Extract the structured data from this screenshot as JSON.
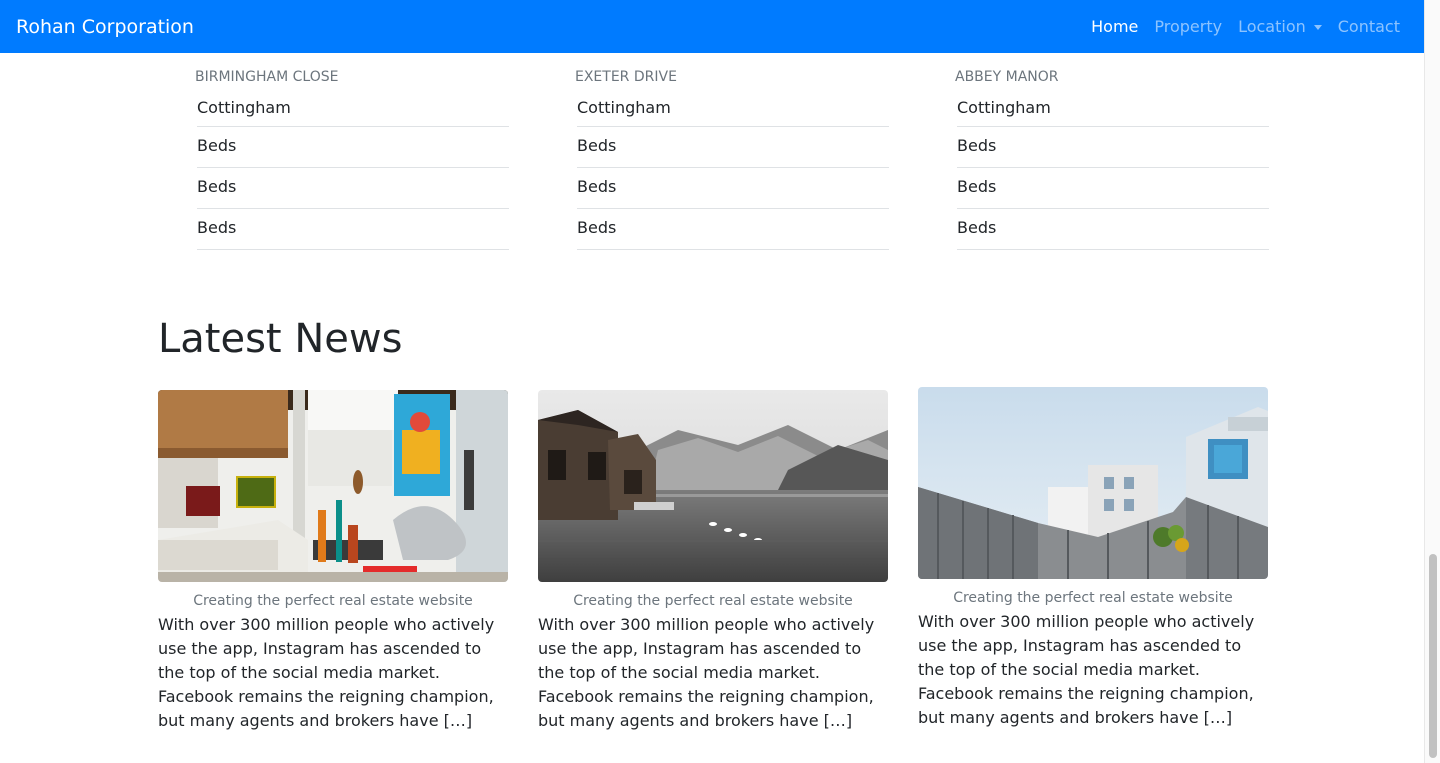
{
  "navbar": {
    "brand": "Rohan Corporation",
    "links": [
      {
        "label": "Home"
      },
      {
        "label": "Property"
      },
      {
        "label": "Location"
      },
      {
        "label": "Contact"
      }
    ]
  },
  "properties": [
    {
      "heading": "BIRMINGHAM CLOSE",
      "items": [
        "Cottingham",
        "Beds",
        "Beds",
        "Beds"
      ]
    },
    {
      "heading": "EXETER DRIVE",
      "items": [
        "Cottingham",
        "Beds",
        "Beds",
        "Beds"
      ]
    },
    {
      "heading": "ABBEY MANOR",
      "items": [
        "Cottingham",
        "Beds",
        "Beds",
        "Beds"
      ]
    }
  ],
  "news": {
    "title": "Latest News",
    "cards": [
      {
        "caption": "Creating the perfect real estate website",
        "text": "With over 300 million people who actively use the app, Instagram has ascended to the top of the social media market. Facebook remains the reigning champion, but many agents and brokers have […]"
      },
      {
        "caption": "Creating the perfect real estate website",
        "text": "With over 300 million people who actively use the app, Instagram has ascended to the top of the social media market. Facebook remains the reigning champion, but many agents and brokers have […]"
      },
      {
        "caption": "Creating the perfect real estate website",
        "text": "With over 300 million people who actively use the app, Instagram has ascended to the top of the social media market. Facebook remains the reigning champion, but many agents and brokers have […]"
      }
    ]
  },
  "colors": {
    "primary": "#007bff",
    "muted": "#6c757d",
    "text": "#212529"
  }
}
